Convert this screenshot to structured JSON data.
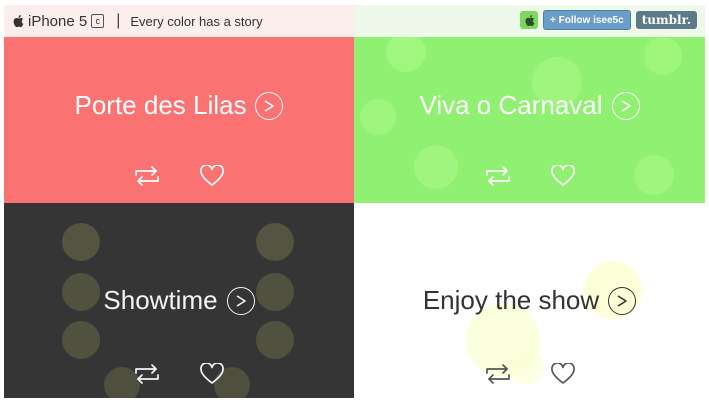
{
  "header": {
    "brand_name": "iPhone 5",
    "model_letter": "c",
    "separator": "|",
    "tagline": "Every color has a story",
    "follow_label": "+ Follow isee5c",
    "tumblr_label": "tumblr."
  },
  "tiles": [
    {
      "title": "Porte des Lilas",
      "background": "#fa7272",
      "text_color": "#ffffff"
    },
    {
      "title": "Viva o Carnaval",
      "background": "#90f071",
      "text_color": "#ffffff"
    },
    {
      "title": "Showtime",
      "background": "#353535",
      "text_color": "#f4f4f4"
    },
    {
      "title": "Enjoy the show",
      "background": "#ffffff",
      "text_color": "#333333"
    }
  ],
  "icons": {
    "apple": "apple-icon",
    "play": "play-icon",
    "reblog": "reblog-icon",
    "like": "heart-icon"
  }
}
